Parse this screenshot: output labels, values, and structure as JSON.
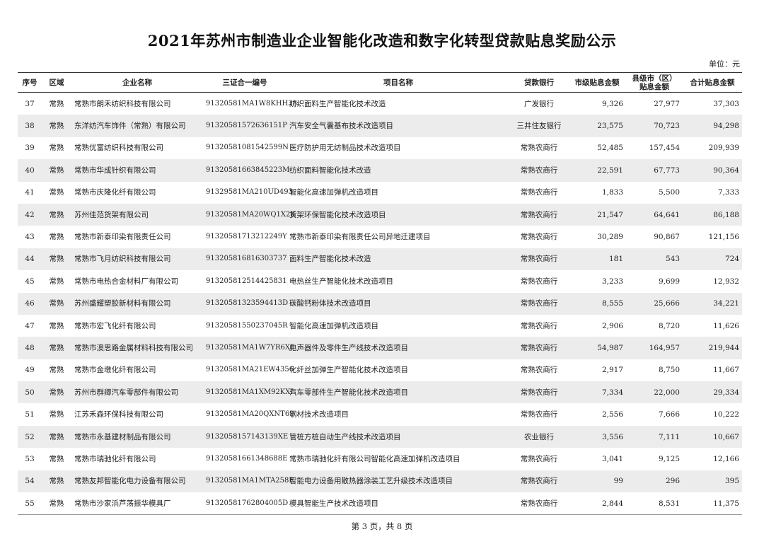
{
  "title": "2021年苏州市制造业企业智能化改造和数字化转型贷款贴息奖励公示",
  "unit": "单位：元",
  "headers": {
    "seq": "序号",
    "region": "区域",
    "company": "企业名称",
    "code": "三证合一编号",
    "project": "项目名称",
    "bank": "贷款银行",
    "city": "市级贴息金额",
    "county_line1": "县级市（区）",
    "county_line2": "贴息金额",
    "total": "合计贴息金额"
  },
  "rows": [
    {
      "seq": "37",
      "region": "常熟",
      "company": "常熟市朗禾纺织科技有限公司",
      "code": "91320581MA1W8KHH38",
      "project": "纺织面料生产智能化技术改造",
      "bank": "广发银行",
      "city": "9,326",
      "county": "27,977",
      "total": "37,303"
    },
    {
      "seq": "38",
      "region": "常熟",
      "company": "东洋纺汽车饰件（常熟）有限公司",
      "code": "91320581572636151P",
      "project": "汽车安全气囊基布技术改造项目",
      "bank": "三井住友银行",
      "city": "23,575",
      "county": "70,723",
      "total": "94,298"
    },
    {
      "seq": "39",
      "region": "常熟",
      "company": "常熟优富纺织科技有限公司",
      "code": "91320581081542599N",
      "project": "医疗防护用无纺制品技术改造项目",
      "bank": "常熟农商行",
      "city": "52,485",
      "county": "157,454",
      "total": "209,939"
    },
    {
      "seq": "40",
      "region": "常熟",
      "company": "常熟市华成针织有限公司",
      "code": "91320581663845223M",
      "project": "纺织面料智能化技术改造",
      "bank": "常熟农商行",
      "city": "22,591",
      "county": "67,773",
      "total": "90,364"
    },
    {
      "seq": "41",
      "region": "常熟",
      "company": "常熟市庆隆化纤有限公司",
      "code": "91329581MA210UD493",
      "project": "智能化高速加弹机改造项目",
      "bank": "常熟农商行",
      "city": "1,833",
      "county": "5,500",
      "total": "7,333"
    },
    {
      "seq": "42",
      "region": "常熟",
      "company": "苏州佳范货架有限公司",
      "code": "91320581MA20WQ1X2K",
      "project": "货架环保智能化技术改造项目",
      "bank": "常熟农商行",
      "city": "21,547",
      "county": "64,641",
      "total": "86,188"
    },
    {
      "seq": "43",
      "region": "常熟",
      "company": "常熟市新泰印染有限责任公司",
      "code": "91320581713212249Y",
      "project": "常熟市新泰印染有限责任公司异地迁建项目",
      "bank": "常熟农商行",
      "city": "30,289",
      "county": "90,867",
      "total": "121,156"
    },
    {
      "seq": "44",
      "region": "常熟",
      "company": "常熟市飞月纺织科技有限公司",
      "code": "91320581681630373​7",
      "project": "面料生产智能化技术改造",
      "bank": "常熟农商行",
      "city": "181",
      "county": "543",
      "total": "724"
    },
    {
      "seq": "45",
      "region": "常熟",
      "company": "常熟市电热合金材料厂有限公司",
      "code": "91320581251442583​1",
      "project": "电热丝生产智能化技术改造项目",
      "bank": "常熟农商行",
      "city": "3,233",
      "county": "9,699",
      "total": "12,932"
    },
    {
      "seq": "46",
      "region": "常熟",
      "company": "苏州盛耀塑胶新材料有限公司",
      "code": "91320581323594413D",
      "project": "碳酸钙粉体技术改造项目",
      "bank": "常熟农商行",
      "city": "8,555",
      "county": "25,666",
      "total": "34,221"
    },
    {
      "seq": "47",
      "region": "常熟",
      "company": "常熟市宏飞化纤有限公司",
      "code": "91320581550237045R",
      "project": "智能化高速加弹机改造项目",
      "bank": "常熟农商行",
      "city": "2,906",
      "county": "8,720",
      "total": "11,626"
    },
    {
      "seq": "48",
      "region": "常熟",
      "company": "常熟市澳思路金属材料科技有限公司",
      "code": "91320581MA1W7YR6XJ",
      "project": "电声器件及零件生产线技术改造项目",
      "bank": "常熟农商行",
      "city": "54,987",
      "county": "164,957",
      "total": "219,944"
    },
    {
      "seq": "49",
      "region": "常熟",
      "company": "常熟市金墩化纤有限公司",
      "code": "91320581MA21EW4356",
      "project": "化纤丝加弹生产智能化技术改造项目",
      "bank": "常熟农商行",
      "city": "2,917",
      "county": "8,750",
      "total": "11,667"
    },
    {
      "seq": "50",
      "region": "常熟",
      "company": "苏州市群卿汽车零部件有限公司",
      "code": "91320581MA1XM92KXL",
      "project": "汽车零部件生产智能化技术改造项目",
      "bank": "常熟农商行",
      "city": "7,334",
      "county": "22,000",
      "total": "29,334"
    },
    {
      "seq": "51",
      "region": "常熟",
      "company": "江苏禾森环保科技有限公司",
      "code": "91320581MA20QXNT69",
      "project": "钢材技术改造项目",
      "bank": "常熟农商行",
      "city": "2,556",
      "county": "7,666",
      "total": "10,222"
    },
    {
      "seq": "52",
      "region": "常熟",
      "company": "常熟市永基建材制品有限公司",
      "code": "91320581571431​39XE",
      "project": "管桩方桩自动生产线技术改造项目",
      "bank": "农业银行",
      "city": "3,556",
      "county": "7,111",
      "total": "10,667"
    },
    {
      "seq": "53",
      "region": "常熟",
      "company": "常熟市瑞驰化纤有限公司",
      "code": "91320581661348688E",
      "project": "常熟市瑞驰化纤有限公司智能化高速加弹机改造项目",
      "bank": "常熟农商行",
      "city": "3,041",
      "county": "9,125",
      "total": "12,166"
    },
    {
      "seq": "54",
      "region": "常熟",
      "company": "常熟友邦智能化电力设备有限公司",
      "code": "91320581MA1MTA258E",
      "project": "智能电力设备用散热器涂装工艺升级技术改造项目",
      "bank": "常熟农商行",
      "city": "99",
      "county": "296",
      "total": "395"
    },
    {
      "seq": "55",
      "region": "常熟",
      "company": "常熟市沙家浜芦荡振华模具厂",
      "code": "91320581762804005D",
      "project": "模具智能生产技术改造项目",
      "bank": "常熟农商行",
      "city": "2,844",
      "county": "8,531",
      "total": "11,375"
    }
  ],
  "footer": "第 3 页，共 8 页"
}
